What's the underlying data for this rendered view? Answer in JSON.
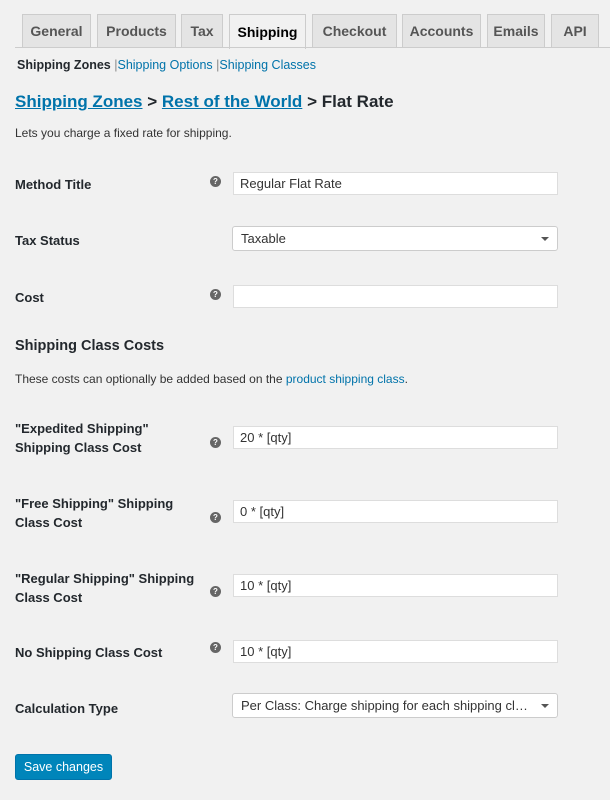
{
  "tabs": [
    {
      "label": "General"
    },
    {
      "label": "Products"
    },
    {
      "label": "Tax"
    },
    {
      "label": "Shipping",
      "active": true
    },
    {
      "label": "Checkout"
    },
    {
      "label": "Accounts"
    },
    {
      "label": "Emails"
    },
    {
      "label": "API"
    }
  ],
  "subnav": {
    "current": "Shipping Zones",
    "links": [
      "Shipping Options",
      "Shipping Classes"
    ],
    "separator": "|"
  },
  "breadcrumb": {
    "zones": "Shipping Zones",
    "zone": "Rest of the World",
    "sep": ">",
    "current": "Flat Rate"
  },
  "description": "Lets you charge a fixed rate for shipping.",
  "fields": {
    "method_title": {
      "label": "Method Title",
      "value": "Regular Flat Rate"
    },
    "tax_status": {
      "label": "Tax Status",
      "value": "Taxable"
    },
    "cost": {
      "label": "Cost",
      "value": ""
    }
  },
  "class_costs": {
    "heading": "Shipping Class Costs",
    "desc_pre": "These costs can optionally be added based on the ",
    "desc_link": "product shipping class",
    "desc_post": ".",
    "expedited": {
      "label": "\"Expedited Shipping\" Shipping Class Cost",
      "value": "20 * [qty]"
    },
    "free": {
      "label": "\"Free Shipping\" Shipping Class Cost",
      "value": "0 * [qty]"
    },
    "regular": {
      "label": "\"Regular Shipping\" Shipping Class Cost",
      "value": "10 * [qty]"
    },
    "none": {
      "label": "No Shipping Class Cost",
      "value": "10 * [qty]"
    },
    "calc": {
      "label": "Calculation Type",
      "value": "Per Class: Charge shipping for each shipping class individually"
    }
  },
  "help_glyph": "?",
  "save_label": "Save changes",
  "colors": {
    "link": "#0073aa",
    "button": "#0085ba"
  }
}
